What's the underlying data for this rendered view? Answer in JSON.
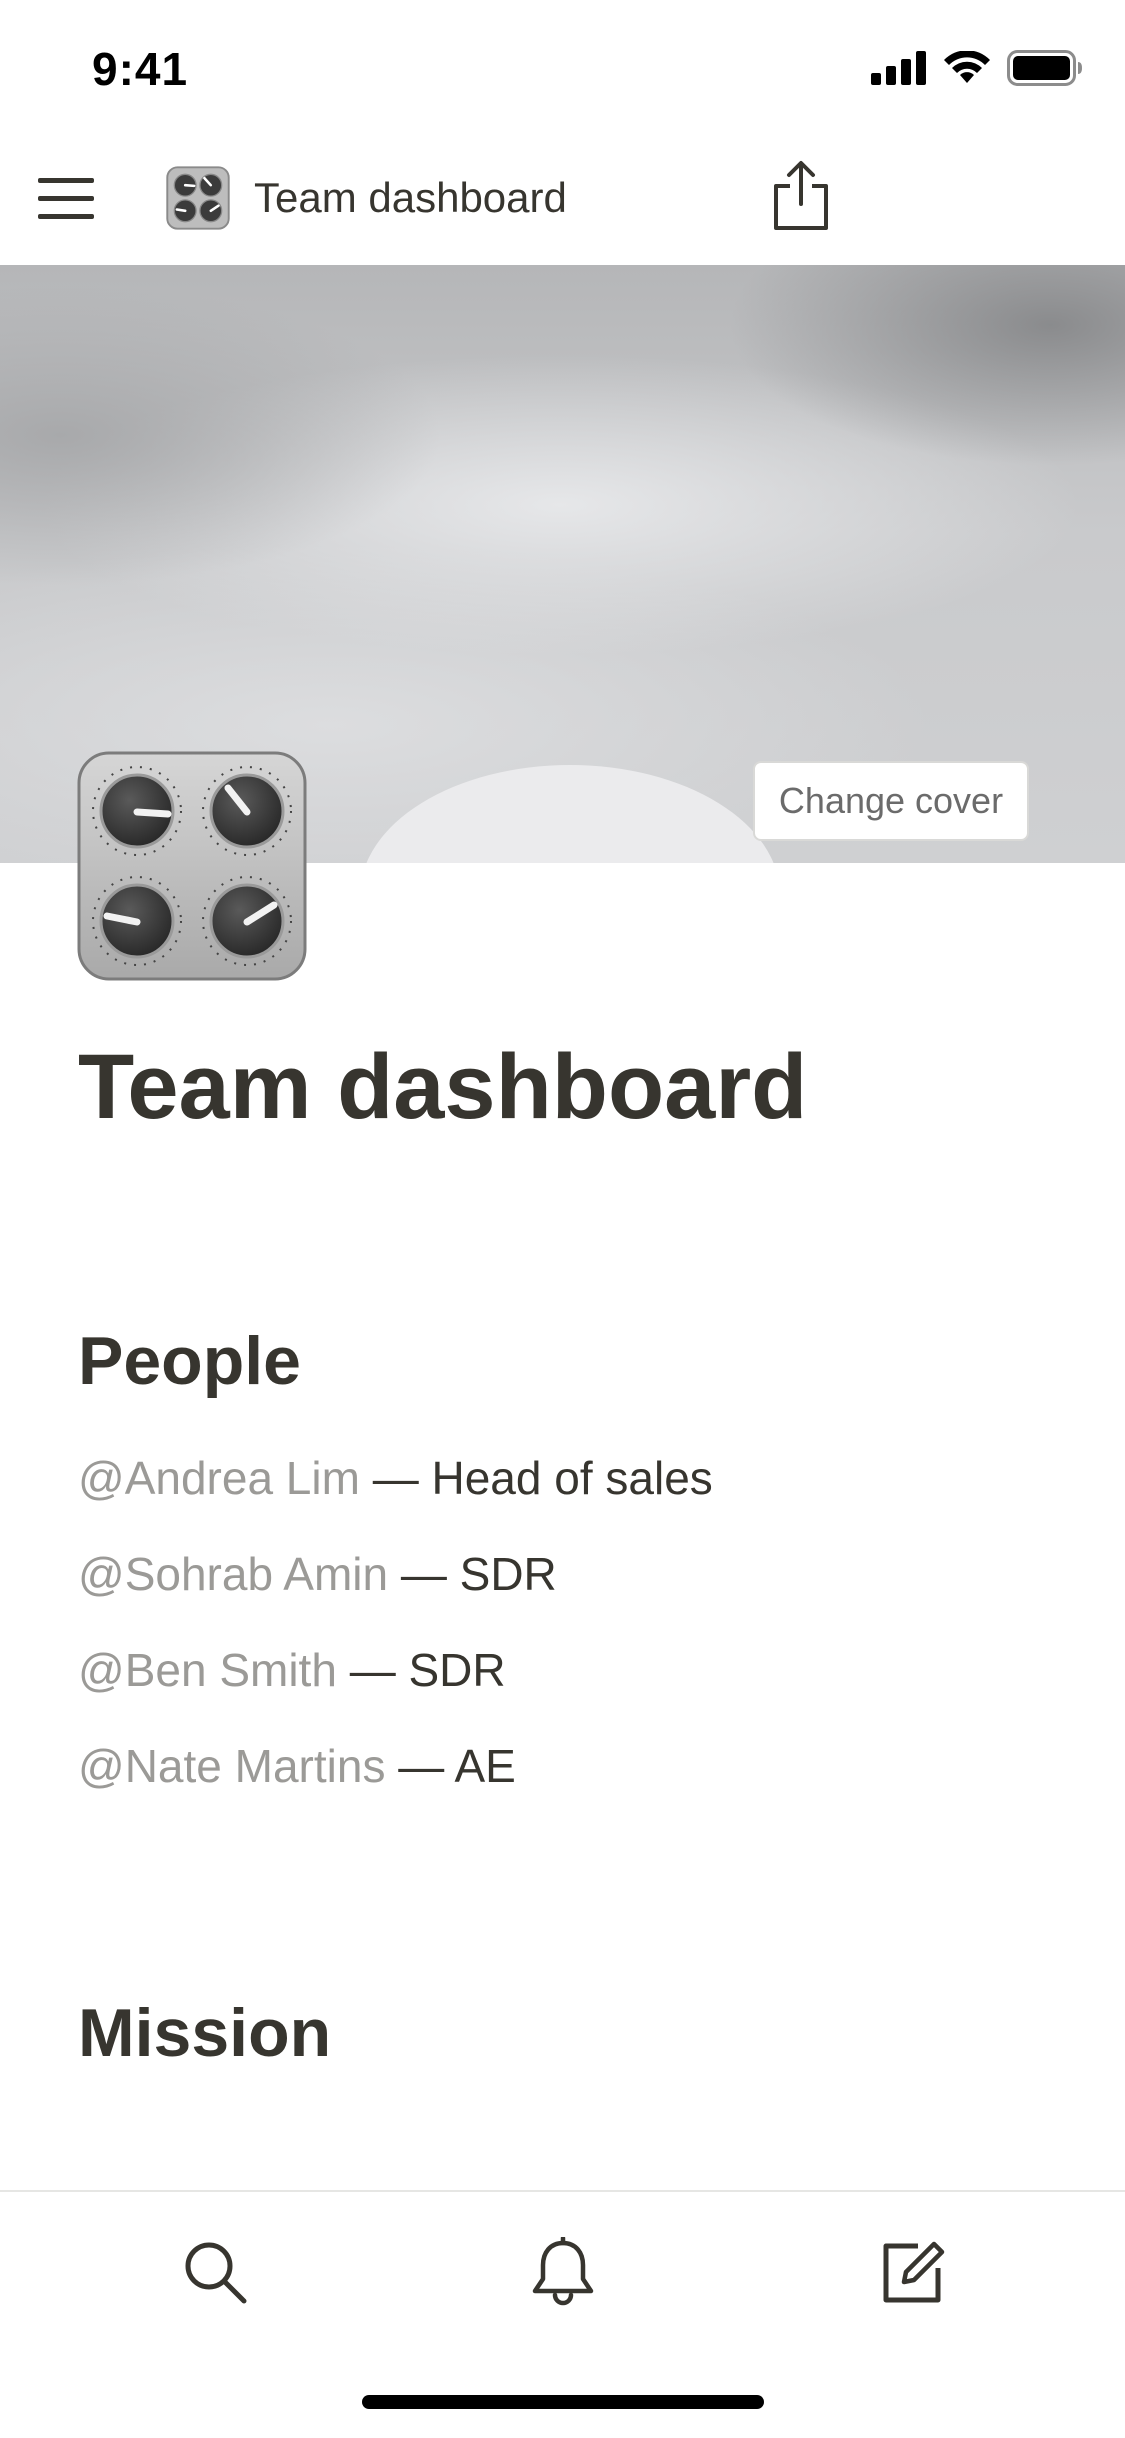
{
  "status_bar": {
    "time": "9:41",
    "icons": [
      "cellular-signal-icon",
      "wifi-icon",
      "battery-icon"
    ]
  },
  "nav": {
    "menu_icon": "hamburger-menu-icon",
    "page_icon": "control-knobs-icon",
    "title": "Team dashboard",
    "share_icon": "share-icon"
  },
  "cover": {
    "change_cover_label": "Change cover"
  },
  "page": {
    "icon": "control-knobs-icon",
    "title": "Team dashboard",
    "sections": {
      "people": {
        "heading": "People",
        "items": [
          {
            "mention": "@Andrea Lim",
            "separator": " — ",
            "role": "Head of sales"
          },
          {
            "mention": "@Sohrab Amin",
            "separator": " — ",
            "role": "SDR"
          },
          {
            "mention": "@Ben Smith",
            "separator": " — ",
            "role": "SDR"
          },
          {
            "mention": "@Nate Martins",
            "separator": " — ",
            "role": "AE"
          }
        ]
      },
      "mission": {
        "heading": "Mission"
      }
    }
  },
  "tab_bar": {
    "items": [
      "search-icon",
      "bell-icon",
      "compose-icon"
    ]
  },
  "colors": {
    "text": "#37352f",
    "mention": "#9b9a97",
    "divider": "#e6e6e4"
  }
}
